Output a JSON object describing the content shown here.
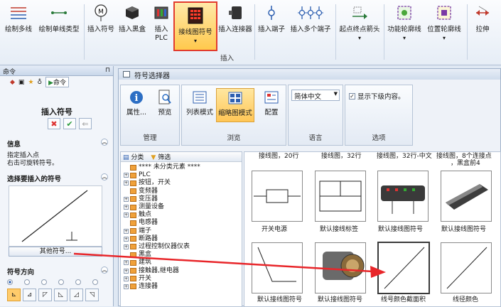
{
  "ribbon": {
    "buttons": [
      {
        "label": "绘制多线",
        "icon": "multi-line-icon"
      },
      {
        "label": "绘制单线类型",
        "icon": "single-line-icon"
      },
      {
        "label": "插入符号",
        "icon": "insert-symbol-icon"
      },
      {
        "label": "插入黑盒",
        "icon": "black-box-icon"
      },
      {
        "label": "插入",
        "label2": "PLC",
        "icon": "plc-icon"
      },
      {
        "label": "接线图符号",
        "icon": "wiring-symbol-icon",
        "dropdown": "▾"
      },
      {
        "label": "插入连接器",
        "icon": "connector-icon"
      },
      {
        "label": "插入端子",
        "icon": "terminal-icon"
      },
      {
        "label": "插入多个端子",
        "icon": "multi-terminal-icon"
      },
      {
        "label": "起点终点箭头",
        "icon": "arrow-icon",
        "dropdown": "▾"
      },
      {
        "label": "功能轮廓线",
        "icon": "function-outline-icon",
        "dropdown": "▾"
      },
      {
        "label": "位置轮廓线",
        "icon": "location-outline-icon",
        "dropdown": "▾"
      },
      {
        "label": "拉伸",
        "icon": "stretch-icon"
      }
    ],
    "group_label": "插入"
  },
  "command_pane": {
    "header": "命令",
    "pin": "⊓",
    "tab_label": "命令",
    "title": "插入符号",
    "actions": {
      "cancel": "✖",
      "ok": "✔",
      "other": "⇐"
    },
    "info_header": "信息",
    "info_lines": [
      "指定插入点",
      "右击可旋转符号。"
    ],
    "select_header": "选择要插入的符号",
    "other_symbol_button": "其他符号...",
    "direction_header": "符号方向",
    "collapse_glyph": "︽"
  },
  "symbol_selector": {
    "title": "符号选择器",
    "groups": {
      "manage": {
        "label": "管理",
        "buttons": [
          "属性...",
          "预览"
        ]
      },
      "browse": {
        "label": "浏览",
        "buttons": [
          "列表模式",
          "缩略图模式",
          "配置"
        ]
      },
      "language": {
        "label": "语言",
        "value": "简体中文"
      },
      "options": {
        "label": "选项",
        "checkbox": "显示下级内容。",
        "checked": "✓"
      }
    },
    "tree": {
      "tab_category": "分类",
      "tab_filter": "筛选",
      "items": [
        {
          "label": "**** 未分类元素 ****",
          "expand": ""
        },
        {
          "label": "PLC",
          "expand": "+"
        },
        {
          "label": "按钮，开关",
          "expand": "+"
        },
        {
          "label": "变频器",
          "expand": ""
        },
        {
          "label": "变压器",
          "expand": "+"
        },
        {
          "label": "测量设备",
          "expand": "+"
        },
        {
          "label": "触点",
          "expand": "+"
        },
        {
          "label": "电感器",
          "expand": ""
        },
        {
          "label": "端子",
          "expand": "+"
        },
        {
          "label": "断路器",
          "expand": "+"
        },
        {
          "label": "过程控制仪器仪表",
          "expand": "+"
        },
        {
          "label": "黑盒",
          "expand": ""
        },
        {
          "label": "建筑",
          "expand": "+"
        },
        {
          "label": "接触器,继电器",
          "expand": "+"
        },
        {
          "label": "开关",
          "expand": "+"
        },
        {
          "label": "连接器",
          "expand": "+"
        }
      ]
    },
    "gallery": {
      "top_captions": [
        "接线图，20行",
        "接线图，32行",
        "接线图，32行-中文",
        "接线图，8个连接点",
        "，黑盒前4"
      ],
      "items": [
        {
          "label": "开关电源"
        },
        {
          "label": "默认接线标签"
        },
        {
          "label": "默认接线图符号"
        },
        {
          "label": "默认接线图符号"
        },
        {
          "label": "默认接线图符号"
        },
        {
          "label": "默认接线图符号"
        },
        {
          "label": "线号颜色截面积"
        },
        {
          "label": "线径颜色"
        }
      ]
    }
  },
  "colors": {
    "active_border": "#e23b2e",
    "arrow": "#e8262a",
    "highlight": "#ffc94d"
  }
}
